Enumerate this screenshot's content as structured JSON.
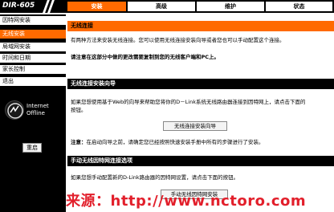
{
  "header": {
    "model": "DIR-605",
    "tabs": [
      {
        "label": "安装",
        "active": true
      },
      {
        "label": "高级",
        "active": false
      },
      {
        "label": "维护",
        "active": false
      },
      {
        "label": "状态",
        "active": false
      }
    ]
  },
  "sidebar": {
    "items": [
      {
        "label": "因特网安装",
        "active": false
      },
      {
        "label": "无线安装",
        "active": true
      },
      {
        "label": "局域网安装",
        "active": false
      },
      {
        "label": "时间和日期",
        "active": false
      },
      {
        "label": "家长控制",
        "active": false
      },
      {
        "label": "退出",
        "active": false
      }
    ],
    "status_line1": "Internet",
    "status_line2": "Offline",
    "reboot_label": "重启"
  },
  "main": {
    "section1": {
      "title": "无线连接",
      "line1": "有两种方法来安装无线连接。您可以使用无线连接安装向导或者您也可以手动配置这个连接。",
      "line2": "请注意在这部分中做的更改需要复制到您的无线客户端和PC上。"
    },
    "section2": {
      "title": "无线连接安装向导",
      "line1": "如果您想使用基于Web的向导来帮助您将你的D－Link系统无线路由器连接到因特网上，请点击下面的",
      "line2": "按钮。",
      "button": "无线连接安装向导",
      "note_label": "注意：",
      "note_text": "在启动向导之前，请确定您已经按照快速安装手册中所有的步骤进行了安装。"
    },
    "section3": {
      "title": "手动无线因特网连接选项",
      "line1": "如果您想手动配置新的D-Link路由器的因特网设置，请点击下面的按钮。",
      "button": "手动无线因特网安装"
    }
  },
  "watermark": "来源：http://www.nctoro.com",
  "colors": {
    "accent": "#ff6a00",
    "watermark": "#e21f2b"
  }
}
